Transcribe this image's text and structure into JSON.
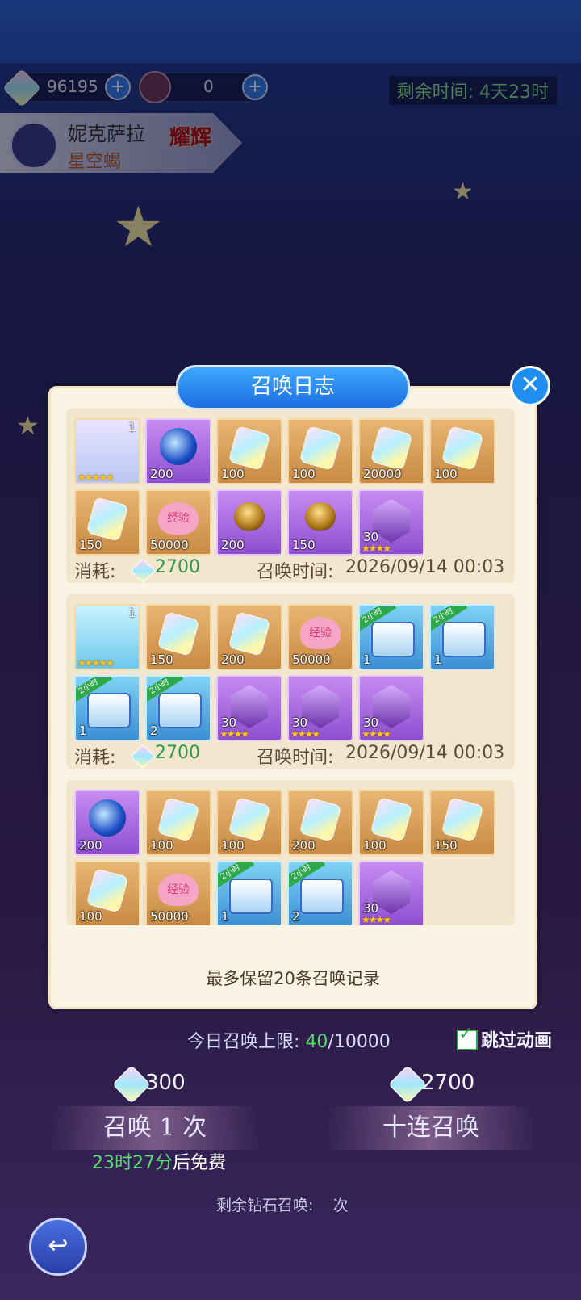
{
  "top": {
    "diamonds": "96195",
    "tickets": "0",
    "time_left": "剩余时间: 4天23时"
  },
  "character": {
    "name": "妮克萨拉",
    "subtitle": "星空蝎",
    "badge": "耀辉"
  },
  "dialog": {
    "title": "召唤日志",
    "footer": "最多保留20条召唤记录",
    "cost_label": "消耗:",
    "time_label": "召唤时间:",
    "records": [
      {
        "cost": "2700",
        "time": "2026/09/14 00:03",
        "items": [
          {
            "kind": "portrait",
            "bg": "gold",
            "count": "1",
            "stars": "★★★★★"
          },
          {
            "kind": "orb",
            "bg": "purple",
            "count": "200"
          },
          {
            "kind": "crystal",
            "bg": "gold",
            "count": "100"
          },
          {
            "kind": "crystal",
            "bg": "gold",
            "count": "100"
          },
          {
            "kind": "crystal",
            "bg": "gold",
            "count": "20000"
          },
          {
            "kind": "crystal",
            "bg": "gold",
            "count": "100"
          },
          {
            "kind": "crystal",
            "bg": "gold",
            "count": "150"
          },
          {
            "kind": "heart",
            "bg": "gold",
            "count": "50000",
            "text": "经验"
          },
          {
            "kind": "egg",
            "bg": "purple",
            "count": "200"
          },
          {
            "kind": "egg",
            "bg": "purple",
            "count": "150"
          },
          {
            "kind": "shard",
            "bg": "purple",
            "count": "30",
            "stars": "★★★★"
          }
        ]
      },
      {
        "cost": "2700",
        "time": "2026/09/14 00:03",
        "items": [
          {
            "kind": "portrait2",
            "bg": "gold",
            "count": "1",
            "stars": "★★★★★"
          },
          {
            "kind": "crystal",
            "bg": "gold",
            "count": "150"
          },
          {
            "kind": "crystal",
            "bg": "gold",
            "count": "200"
          },
          {
            "kind": "heart",
            "bg": "gold",
            "count": "50000",
            "text": "经验"
          },
          {
            "kind": "chest",
            "bg": "blue",
            "count": "1",
            "tag": "2小时"
          },
          {
            "kind": "chest",
            "bg": "blue",
            "count": "1",
            "tag": "2小时"
          },
          {
            "kind": "chest",
            "bg": "blue",
            "count": "1",
            "tag": "2小时"
          },
          {
            "kind": "chest",
            "bg": "blue",
            "count": "2",
            "tag": "2小时"
          },
          {
            "kind": "shard",
            "bg": "purple",
            "count": "30",
            "stars": "★★★★"
          },
          {
            "kind": "shard",
            "bg": "purple",
            "count": "30",
            "stars": "★★★★"
          },
          {
            "kind": "shard",
            "bg": "purple",
            "count": "30",
            "stars": "★★★★"
          }
        ]
      },
      {
        "cost": "",
        "time": "",
        "items": [
          {
            "kind": "orb",
            "bg": "purple",
            "count": "200"
          },
          {
            "kind": "crystal",
            "bg": "gold",
            "count": "100"
          },
          {
            "kind": "crystal",
            "bg": "gold",
            "count": "100"
          },
          {
            "kind": "crystal",
            "bg": "gold",
            "count": "200"
          },
          {
            "kind": "crystal",
            "bg": "gold",
            "count": "100"
          },
          {
            "kind": "crystal",
            "bg": "gold",
            "count": "150"
          },
          {
            "kind": "crystal",
            "bg": "gold",
            "count": "100"
          },
          {
            "kind": "heart",
            "bg": "gold",
            "count": "50000",
            "text": "经验"
          },
          {
            "kind": "chest",
            "bg": "blue",
            "count": "1",
            "tag": "2小时"
          },
          {
            "kind": "chest",
            "bg": "blue",
            "count": "2",
            "tag": "2小时"
          },
          {
            "kind": "shard",
            "bg": "purple",
            "count": "30",
            "stars": "★★★★"
          }
        ]
      }
    ]
  },
  "bottom": {
    "limit_prefix": "今日召唤上限: ",
    "limit_used": "40",
    "limit_total": "/10000",
    "skip_label": "跳过动画",
    "single_cost": "300",
    "ten_cost": "2700",
    "single_label": "召唤 1 次",
    "ten_label": "十连召唤",
    "free_time": "23时27分",
    "free_suffix": "后免费",
    "remain_prefix": "剩余钻石召唤:",
    "remain_suffix": "次"
  }
}
